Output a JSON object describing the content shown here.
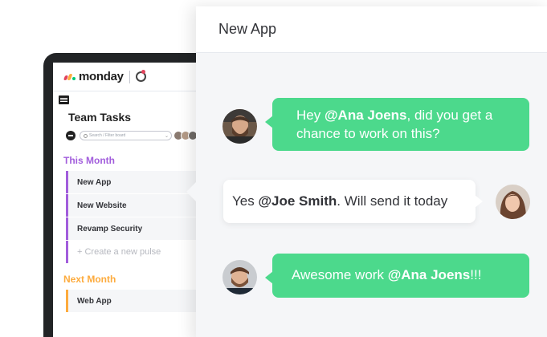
{
  "board": {
    "logo_text": "monday",
    "logo_colors": [
      "#e2445c",
      "#fdab3d",
      "#00c875"
    ],
    "title": "Team Tasks",
    "search_placeholder": "Search / Filter board",
    "groups": [
      {
        "title": "This Month",
        "color": "#a25ddc",
        "items": [
          "New App",
          "New Website",
          "Revamp Security"
        ],
        "new_item_placeholder": "+ Create a new pulse"
      },
      {
        "title": "Next Month",
        "color": "#fdab3d",
        "items": [
          "Web App"
        ]
      }
    ]
  },
  "chat": {
    "title": "New App",
    "bubble_green": "#4cd98c",
    "messages": [
      {
        "side": "left",
        "avatar": "bearded-man-avatar-icon",
        "before": "Hey ",
        "mention": "@Ana Joens",
        "after": ", did you get a chance to work on this?"
      },
      {
        "side": "right",
        "avatar": "woman-avatar-icon",
        "before": "Yes ",
        "mention": "@Joe Smith",
        "after": ". Will send it today"
      },
      {
        "side": "left",
        "avatar": "bearded-man-avatar-icon",
        "before": "Awesome work ",
        "mention": "@Ana Joens",
        "after": "!!!"
      }
    ]
  }
}
